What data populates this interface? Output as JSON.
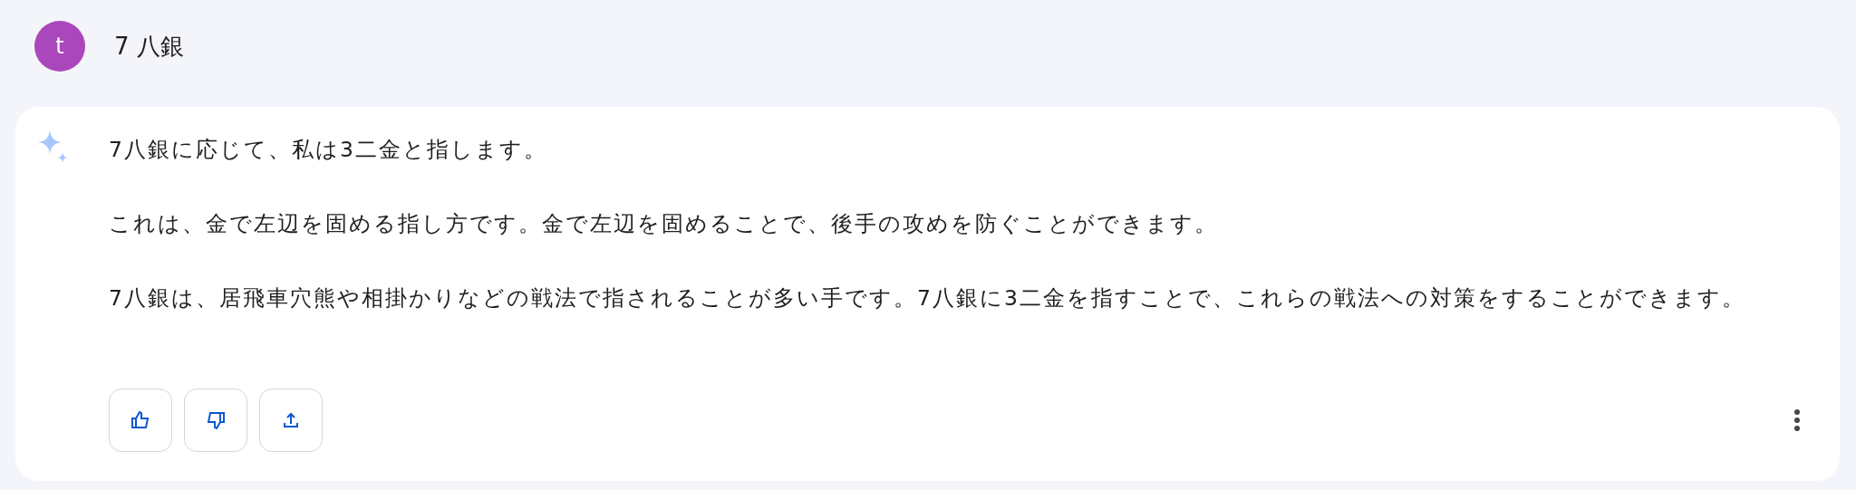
{
  "user": {
    "avatar_letter": "t",
    "query": "7 八銀"
  },
  "response": {
    "paragraphs": [
      "7八銀に応じて、私は3二金と指します。",
      "これは、金で左辺を固める指し方です。金で左辺を固めることで、後手の攻めを防ぐことができます。",
      "7八銀は、居飛車穴熊や相掛かりなどの戦法で指されることが多い手です。7八銀に3二金を指すことで、これらの戦法への対策をすることができます。"
    ],
    "actions": [
      {
        "kind": "thumbs-up"
      },
      {
        "kind": "thumbs-down"
      },
      {
        "kind": "share"
      }
    ]
  }
}
